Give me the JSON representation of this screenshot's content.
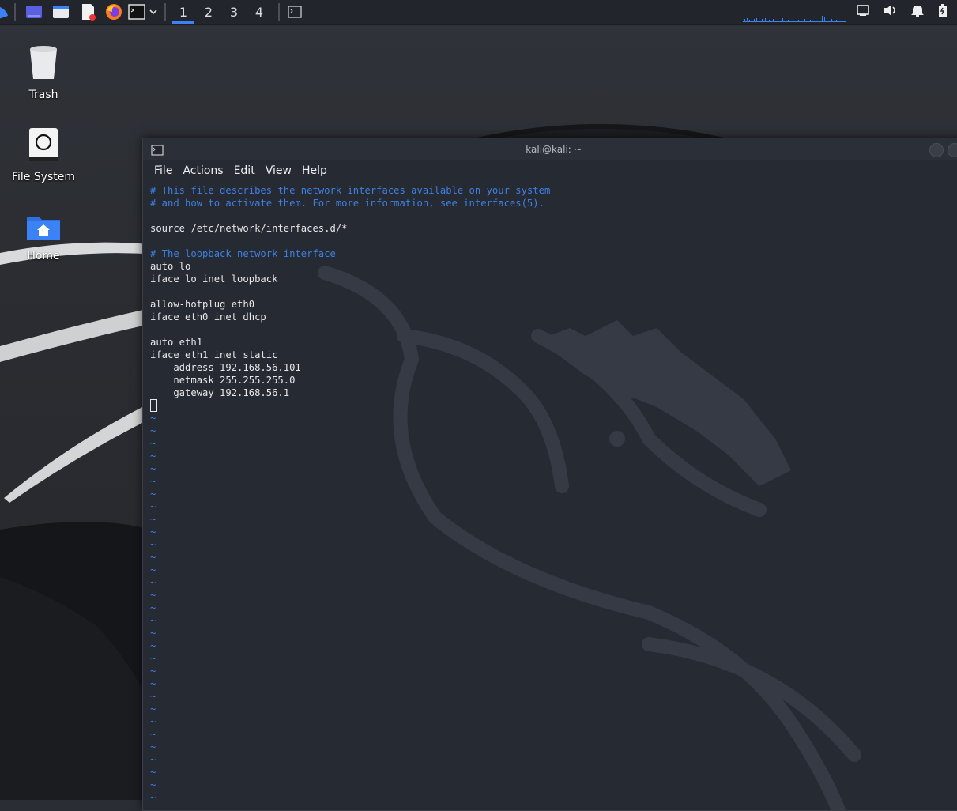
{
  "panel": {
    "workspaces": [
      "1",
      "2",
      "3",
      "4"
    ],
    "active_workspace": "1"
  },
  "desktop": {
    "icons": [
      {
        "label": "Trash"
      },
      {
        "label": "File System"
      },
      {
        "label": "Home"
      }
    ]
  },
  "terminal": {
    "title": "kali@kali: ~",
    "menu": [
      "File",
      "Actions",
      "Edit",
      "View",
      "Help"
    ],
    "lines": [
      {
        "text": "# This file describes the network interfaces available on your system",
        "kind": "comment"
      },
      {
        "text": "# and how to activate them. For more information, see interfaces(5).",
        "kind": "comment"
      },
      {
        "text": "",
        "kind": "text"
      },
      {
        "text": "source /etc/network/interfaces.d/*",
        "kind": "text"
      },
      {
        "text": "",
        "kind": "text"
      },
      {
        "text": "# The loopback network interface",
        "kind": "comment"
      },
      {
        "text": "auto lo",
        "kind": "text"
      },
      {
        "text": "iface lo inet loopback",
        "kind": "text"
      },
      {
        "text": "",
        "kind": "text"
      },
      {
        "text": "allow-hotplug eth0",
        "kind": "text"
      },
      {
        "text": "iface eth0 inet dhcp",
        "kind": "text"
      },
      {
        "text": "",
        "kind": "text"
      },
      {
        "text": "auto eth1",
        "kind": "text"
      },
      {
        "text": "iface eth1 inet static",
        "kind": "text"
      },
      {
        "text": "    address 192.168.56.101",
        "kind": "text"
      },
      {
        "text": "    netmask 255.255.255.0",
        "kind": "text"
      },
      {
        "text": "    gateway 192.168.56.1",
        "kind": "text"
      }
    ],
    "tilde": "~",
    "tilde_count": 31
  }
}
